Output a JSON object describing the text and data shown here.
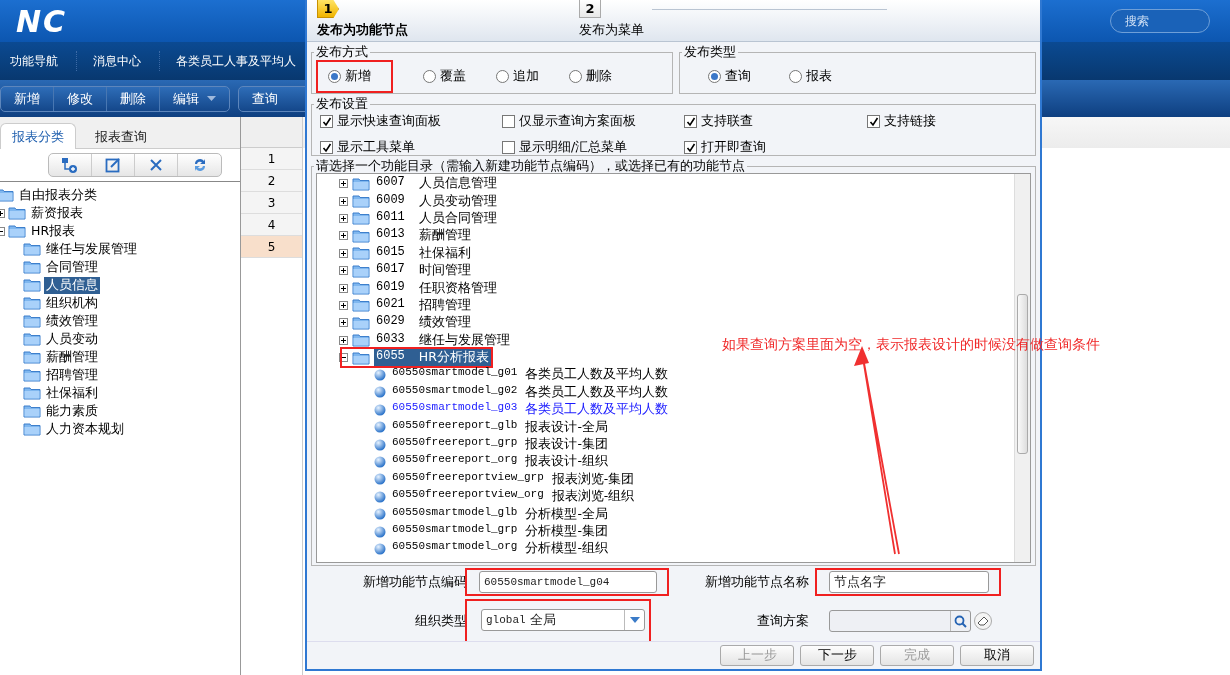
{
  "app": {
    "logo": "NC",
    "search": {
      "placeholder": "搜索"
    },
    "nav": [
      {
        "label": "功能导航"
      },
      {
        "label": "消息中心"
      },
      {
        "label": "各类员工人事及平均人"
      }
    ],
    "toolbar": [
      {
        "label": "新增",
        "kind": "button"
      },
      {
        "label": "修改",
        "kind": "button"
      },
      {
        "label": "删除",
        "kind": "button"
      },
      {
        "label": "编辑",
        "kind": "dropdown"
      },
      {
        "label": "查询",
        "kind": "button"
      }
    ],
    "left_tabs": [
      {
        "label": "报表分类",
        "selected": true
      },
      {
        "label": "报表查询",
        "selected": false
      }
    ],
    "category_tree": [
      {
        "label": "自由报表分类",
        "selected": false,
        "children": [
          {
            "label": "薪资报表",
            "expanded": false,
            "selected": false
          },
          {
            "label": "HR报表",
            "expanded": true,
            "selected": false,
            "children": [
              {
                "label": "继任与发展管理",
                "selected": false
              },
              {
                "label": "合同管理",
                "selected": false
              },
              {
                "label": "人员信息",
                "selected": true
              },
              {
                "label": "组织机构",
                "selected": false
              },
              {
                "label": "绩效管理",
                "selected": false
              },
              {
                "label": "人员变动",
                "selected": false
              },
              {
                "label": "薪酬管理",
                "selected": false
              },
              {
                "label": "招聘管理",
                "selected": false
              },
              {
                "label": "社保福利",
                "selected": false
              },
              {
                "label": "能力素质",
                "selected": false
              },
              {
                "label": "人力资本规划",
                "selected": false
              }
            ]
          }
        ]
      }
    ],
    "grid_rows": [
      {
        "number": "1",
        "selected": false
      },
      {
        "number": "2",
        "selected": false
      },
      {
        "number": "3",
        "selected": false
      },
      {
        "number": "4",
        "selected": false
      },
      {
        "number": "5",
        "selected": true
      }
    ]
  },
  "dialog": {
    "steps": [
      {
        "number": "1",
        "label": "发布为功能节点",
        "selected": true
      },
      {
        "number": "2",
        "label": "发布为菜单",
        "selected": false
      }
    ],
    "publish_mode": {
      "legend": "发布方式",
      "options": [
        {
          "label": "新增",
          "selected": true,
          "outlined": true
        },
        {
          "label": "覆盖",
          "selected": false,
          "outlined": false
        },
        {
          "label": "追加",
          "selected": false,
          "outlined": false
        },
        {
          "label": "删除",
          "selected": false,
          "outlined": false
        }
      ]
    },
    "publish_type": {
      "legend": "发布类型",
      "options": [
        {
          "label": "查询",
          "selected": true
        },
        {
          "label": "报表",
          "selected": false
        }
      ]
    },
    "settings": {
      "legend": "发布设置",
      "options": [
        {
          "label": "显示快速查询面板",
          "checked": true
        },
        {
          "label": "仅显示查询方案面板",
          "checked": false
        },
        {
          "label": "支持联查",
          "checked": true
        },
        {
          "label": "支持链接",
          "checked": true
        },
        {
          "label": "显示工具菜单",
          "checked": true
        },
        {
          "label": "显示明细/汇总菜单",
          "checked": false
        },
        {
          "label": "打开即查询",
          "checked": true
        }
      ]
    },
    "node_tree": {
      "legend": "请选择一个功能目录（需输入新建功能节点编码），或选择已有的功能节点",
      "rows": [
        {
          "code": "6007",
          "name": "人员信息管理",
          "expanded": false,
          "selected": false,
          "outlined": false
        },
        {
          "code": "6009",
          "name": "人员变动管理",
          "expanded": false,
          "selected": false,
          "outlined": false
        },
        {
          "code": "6011",
          "name": "人员合同管理",
          "expanded": false,
          "selected": false,
          "outlined": false
        },
        {
          "code": "6013",
          "name": "薪酬管理",
          "expanded": false,
          "selected": false,
          "outlined": false
        },
        {
          "code": "6015",
          "name": "社保福利",
          "expanded": false,
          "selected": false,
          "outlined": false
        },
        {
          "code": "6017",
          "name": "时间管理",
          "expanded": false,
          "selected": false,
          "outlined": false
        },
        {
          "code": "6019",
          "name": "任职资格管理",
          "expanded": false,
          "selected": false,
          "outlined": false
        },
        {
          "code": "6021",
          "name": "招聘管理",
          "expanded": false,
          "selected": false,
          "outlined": false
        },
        {
          "code": "6029",
          "name": "绩效管理",
          "expanded": false,
          "selected": false,
          "outlined": false
        },
        {
          "code": "6033",
          "name": "继任与发展管理",
          "expanded": false,
          "selected": false,
          "outlined": false
        },
        {
          "code": "6055",
          "name": "HR分析报表",
          "expanded": true,
          "selected": true,
          "outlined": true,
          "children": [
            {
              "code": "60550smartmodel_g01",
              "name": "各类员工人数及平均人数",
              "highlighted": false
            },
            {
              "code": "60550smartmodel_g02",
              "name": "各类员工人数及平均人数",
              "highlighted": false
            },
            {
              "code": "60550smartmodel_g03",
              "name": "各类员工人数及平均人数",
              "highlighted": true
            },
            {
              "code": "60550freereport_glb",
              "name": "报表设计-全局",
              "highlighted": false
            },
            {
              "code": "60550freereport_grp",
              "name": "报表设计-集团",
              "highlighted": false
            },
            {
              "code": "60550freereport_org",
              "name": "报表设计-组织",
              "highlighted": false
            },
            {
              "code": "60550freereportview_grp",
              "name": "报表浏览-集团",
              "highlighted": false
            },
            {
              "code": "60550freereportview_org",
              "name": "报表浏览-组织",
              "highlighted": false
            },
            {
              "code": "60550smartmodel_glb",
              "name": "分析模型-全局",
              "highlighted": false
            },
            {
              "code": "60550smartmodel_grp",
              "name": "分析模型-集团",
              "highlighted": false
            },
            {
              "code": "60550smartmodel_org",
              "name": "分析模型-组织",
              "highlighted": false
            }
          ]
        }
      ]
    },
    "fields": [
      {
        "label": "新增功能节点编码",
        "value": "60550smartmodel_g04",
        "kind": "text",
        "outlined": true
      },
      {
        "label": "新增功能节点名称",
        "value": "节点名字",
        "kind": "text",
        "outlined": true
      },
      {
        "label": "组织类型",
        "value": "global 全局",
        "kind": "select",
        "outlined": true
      },
      {
        "label": "查询方案",
        "kind": "lookup",
        "outlined": false
      }
    ],
    "buttons": [
      {
        "label": "上一步",
        "disabled": true
      },
      {
        "label": "下一步",
        "disabled": false
      },
      {
        "label": "完成",
        "disabled": true
      },
      {
        "label": "取消",
        "disabled": false
      }
    ]
  },
  "annotation": {
    "note": "如果查询方案里面为空，表示报表设计的时候没有做查询条件"
  }
}
